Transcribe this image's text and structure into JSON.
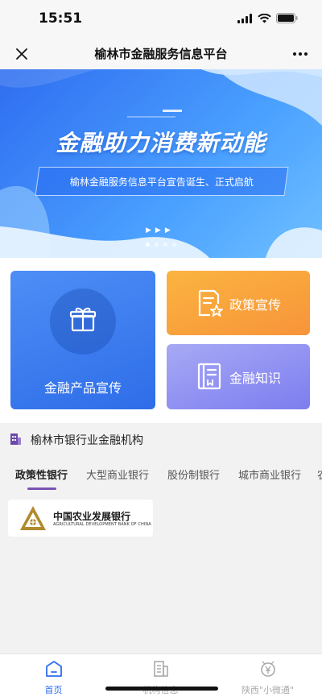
{
  "status_bar": {
    "time": "15:51"
  },
  "nav": {
    "title": "榆林市金融服务信息平台",
    "close_icon": "close-icon",
    "more_icon": "more-icon"
  },
  "banner": {
    "headline": "金融助力消费新动能",
    "subtitle": "榆林金融服务信息平台宣告诞生、正式启航",
    "arrows": "▶▶▶",
    "slide_count": 4,
    "active_slide": 1
  },
  "tiles": {
    "product": {
      "label": "金融产品宣传",
      "icon": "gift-icon"
    },
    "policy": {
      "label": "政策宣传",
      "icon": "policy-document-icon"
    },
    "knowledge": {
      "label": "金融知识",
      "icon": "book-icon"
    }
  },
  "section": {
    "title": "榆林市银行业金融机构",
    "icon": "building-icon"
  },
  "tabs": [
    {
      "label": "政策性银行",
      "active": true
    },
    {
      "label": "大型商业银行",
      "active": false
    },
    {
      "label": "股份制银行",
      "active": false
    },
    {
      "label": "城市商业银行",
      "active": false
    },
    {
      "label": "农",
      "active": false
    }
  ],
  "banks": [
    {
      "name": "中国农业发展银行",
      "english": "AGRICULTURAL DEVELOPMENT BANK OF CHINA"
    }
  ],
  "bottom_nav": [
    {
      "label": "首页",
      "icon": "home-icon",
      "active": true
    },
    {
      "label": "机构信息",
      "icon": "institution-icon",
      "active": false
    },
    {
      "label": "陕西\"小微通\"",
      "icon": "yuan-coin-icon",
      "active": false
    }
  ],
  "colors": {
    "accent_blue": "#2f6df0",
    "orange": "#f7943a",
    "purple": "#7d7df0",
    "tab_underline": "#7a52b3"
  }
}
